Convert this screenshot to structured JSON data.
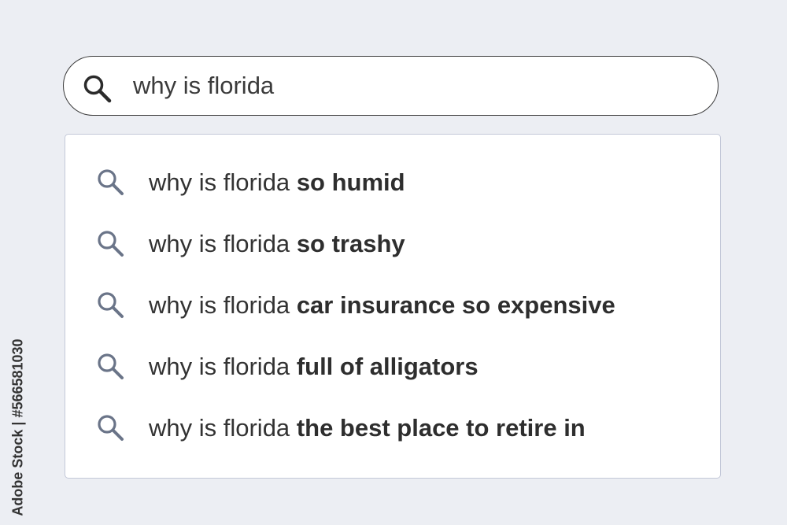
{
  "search": {
    "query": "why is florida",
    "icon": "search-icon"
  },
  "suggestions": [
    {
      "prefix": "why is florida",
      "completion": "so humid",
      "icon": "search-icon"
    },
    {
      "prefix": "why is florida",
      "completion": "so trashy",
      "icon": "search-icon"
    },
    {
      "prefix": "why is florida",
      "completion": "car insurance so expensive",
      "icon": "search-icon"
    },
    {
      "prefix": "why is florida",
      "completion": "full of alligators",
      "icon": "search-icon"
    },
    {
      "prefix": "why is florida",
      "completion": "the best place to retire in",
      "icon": "search-icon"
    }
  ],
  "watermark": {
    "text": "Adobe Stock | #566581030"
  },
  "colors": {
    "background": "#eceef3",
    "search_icon_main": "#2b2b2b",
    "suggestion_icon": "#6a7488",
    "dropdown_border": "#c3c8d8"
  }
}
